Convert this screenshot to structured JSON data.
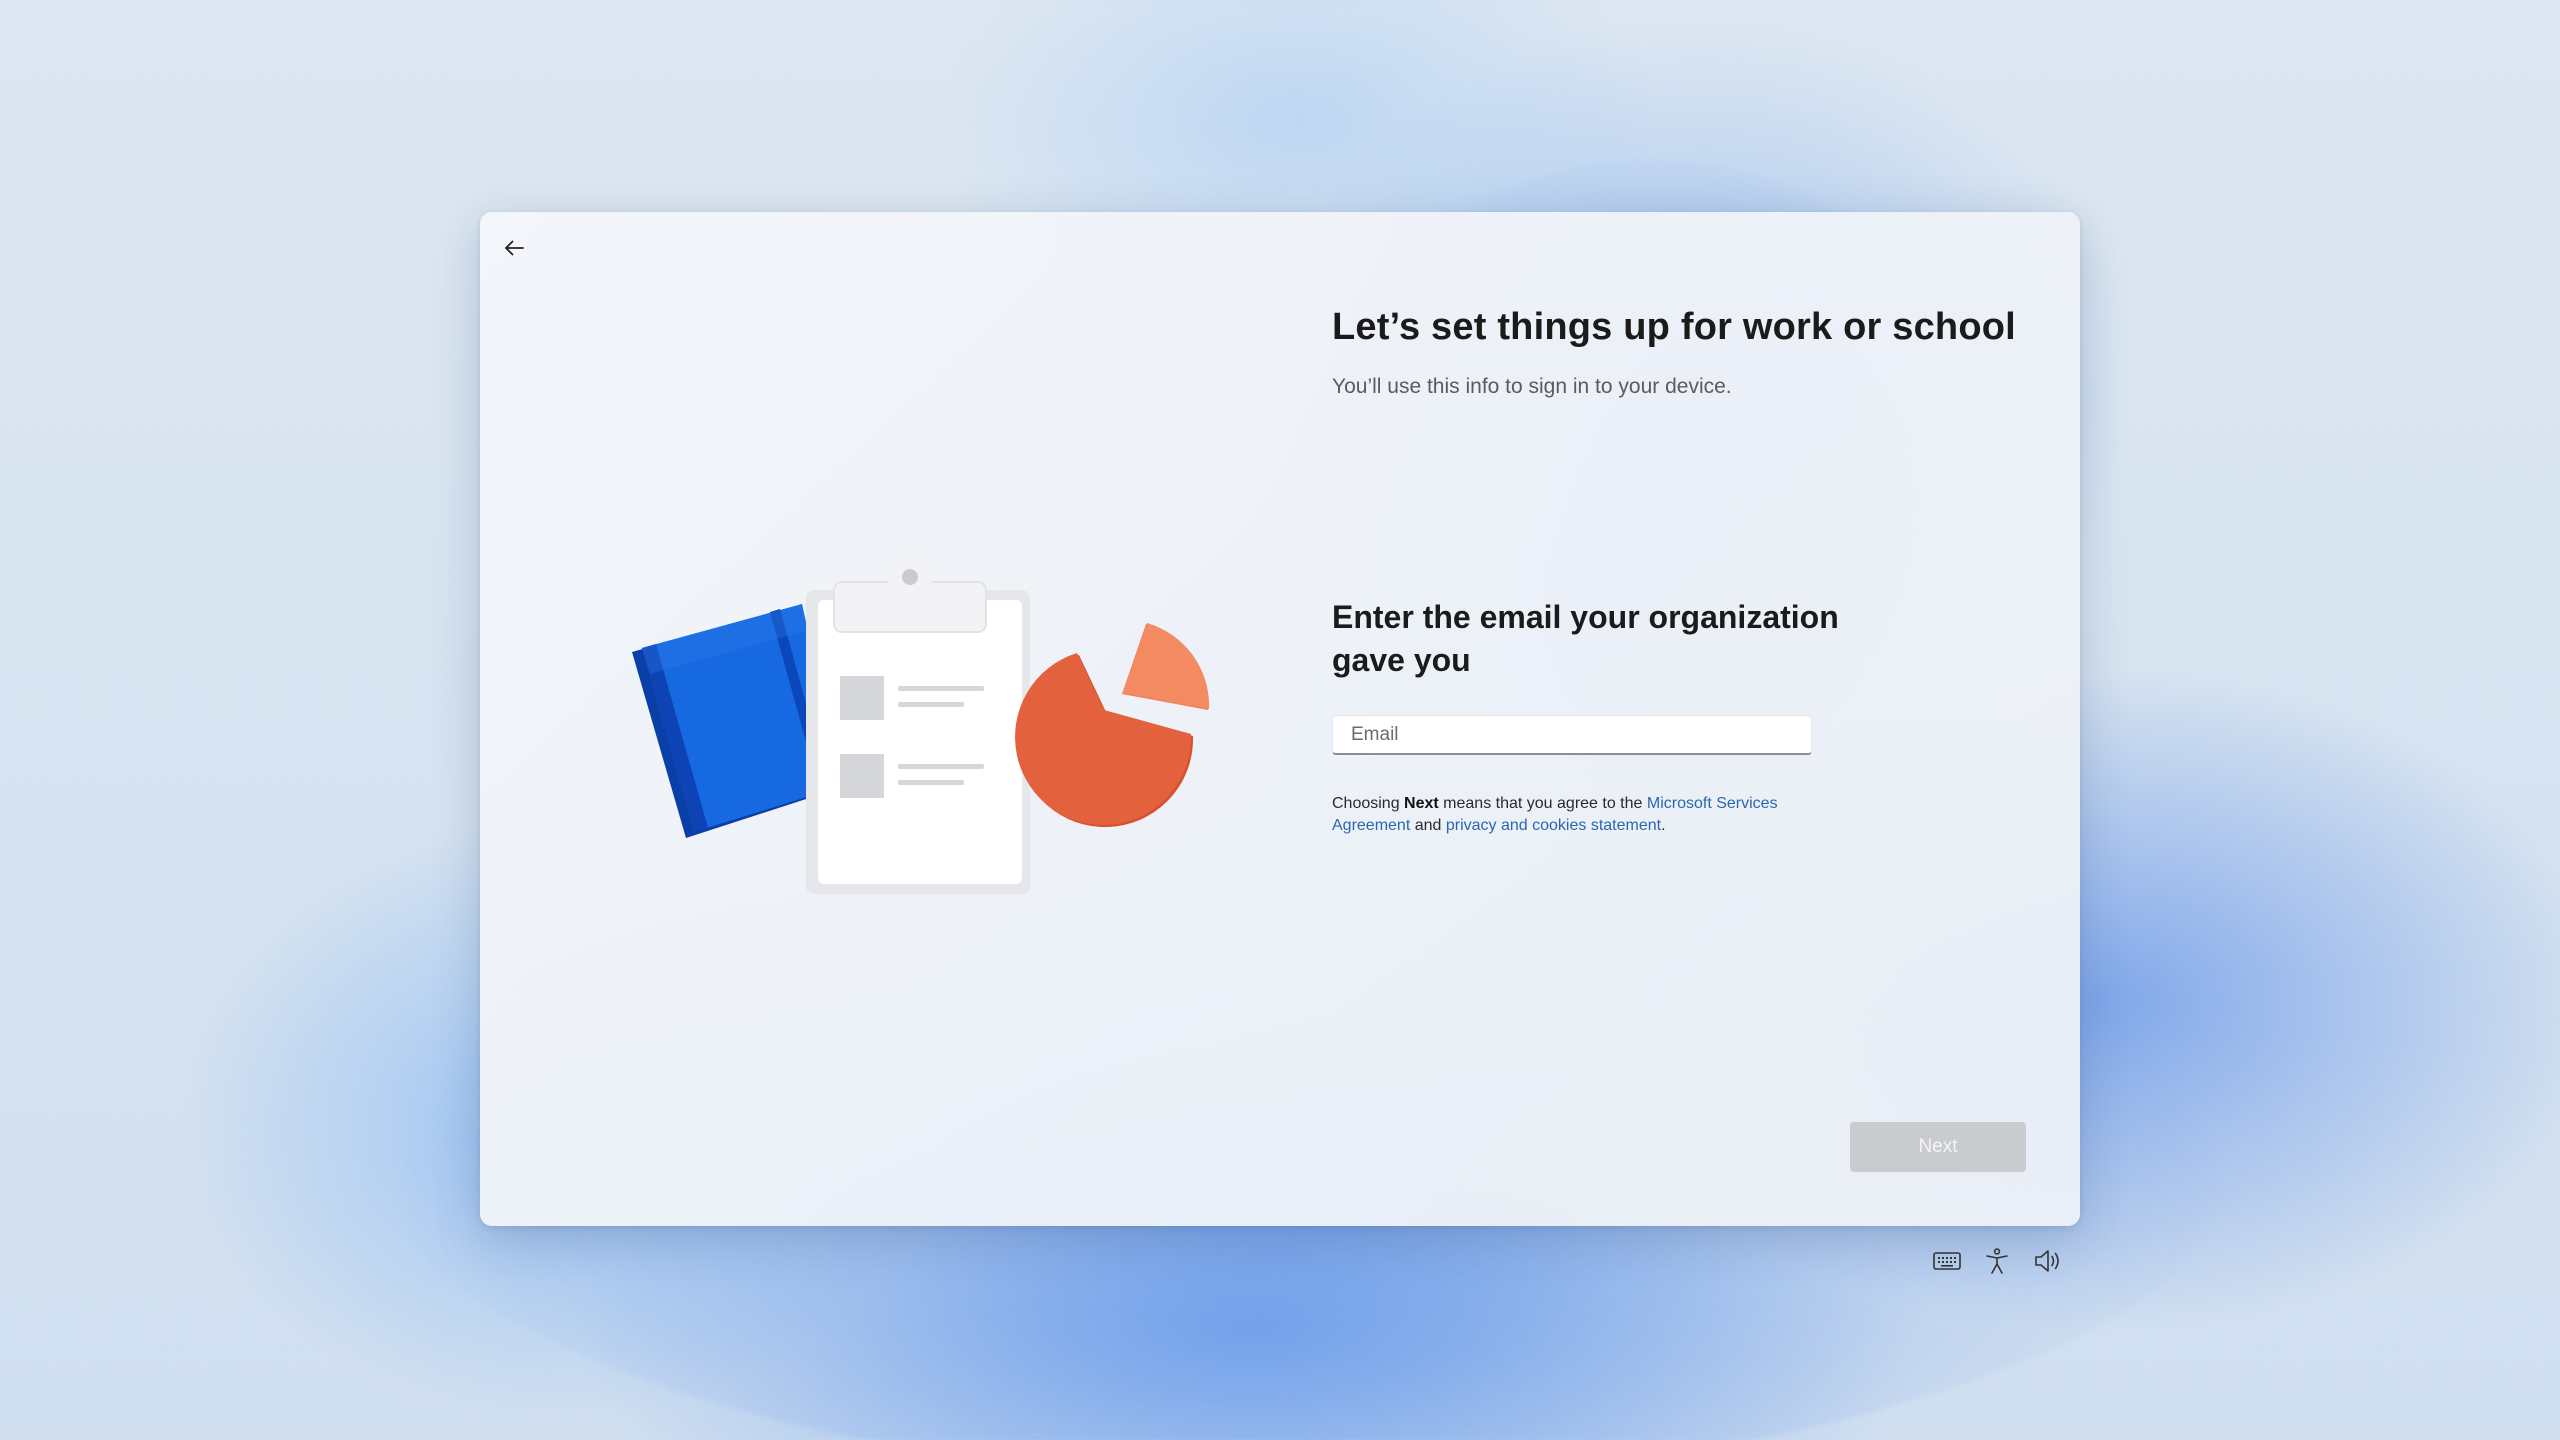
{
  "header": {
    "back_icon": "arrow-left-icon"
  },
  "main": {
    "title": "Let’s set things up for work or school",
    "subtitle": "You’ll use this info to sign in to your device.",
    "section_heading": "Enter the email your organization gave you",
    "email_field": {
      "placeholder": "Email",
      "value": ""
    },
    "legal": {
      "prefix": "Choosing ",
      "bold": "Next",
      "middle": " means that you agree to the ",
      "link1": "Microsoft Services Agreement",
      "and": " and ",
      "link2": "privacy and cookies statement",
      "suffix": "."
    },
    "next_label": "Next"
  },
  "illustration": {
    "icons": [
      "notebook-icon",
      "clipboard-icon",
      "pie-chart-icon"
    ],
    "colors": {
      "notebook": "#1565d8",
      "clipboard": "#ffffff",
      "pie": "#e5603a"
    }
  },
  "tray": {
    "icons": [
      "keyboard-icon",
      "accessibility-icon",
      "volume-icon"
    ]
  },
  "colors": {
    "link": "#2b66b3",
    "next_disabled": "#c9cbcf",
    "window_bg": "#f2f4f8"
  }
}
